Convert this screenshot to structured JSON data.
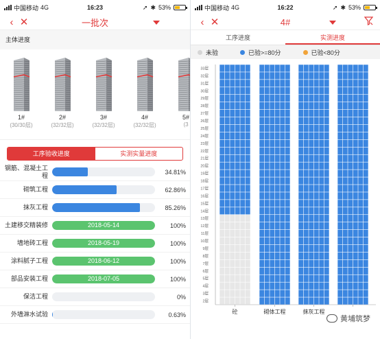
{
  "colors": {
    "accent": "#e03a3a",
    "blue": "#3b86e0",
    "green": "#5bc46f",
    "grey": "#e7e7e7",
    "orange": "#f1a43a"
  },
  "left": {
    "status": {
      "carrier": "中国移动",
      "network": "4G",
      "time": "16:23",
      "battery": "53%"
    },
    "nav": {
      "title": "一批次"
    },
    "section": "主体进度",
    "buildings": [
      {
        "name": "1#",
        "sub": "(30/30层)"
      },
      {
        "name": "2#",
        "sub": "(32/32层)"
      },
      {
        "name": "3#",
        "sub": "(32/32层)"
      },
      {
        "name": "4#",
        "sub": "(32/32层)"
      },
      {
        "name": "5#",
        "sub": "(3"
      }
    ],
    "tabs": [
      "工序验收进度",
      "实测实量进度"
    ],
    "rows": [
      {
        "label": "钢筋、混凝土工程",
        "progress": 0.3481,
        "pct": "34.81%"
      },
      {
        "label": "砌筑工程",
        "progress": 0.6286,
        "pct": "62.86%"
      },
      {
        "label": "抹灰工程",
        "progress": 0.8526,
        "pct": "85.26%"
      },
      {
        "label": "土建移交精装修",
        "progress": 1.0,
        "date": "2018-05-14",
        "pct": "100%"
      },
      {
        "label": "墙地砖工程",
        "progress": 1.0,
        "date": "2018-05-19",
        "pct": "100%"
      },
      {
        "label": "涂料腻子工程",
        "progress": 1.0,
        "date": "2018-06-12",
        "pct": "100%"
      },
      {
        "label": "部品安装工程",
        "progress": 1.0,
        "date": "2018-07-05",
        "pct": "100%"
      },
      {
        "label": "保洁工程",
        "progress": 0,
        "pct": "0%"
      },
      {
        "label": "外墙淋水试验",
        "progress": 0.0063,
        "pct": "0.63%"
      }
    ]
  },
  "right": {
    "status": {
      "carrier": "中国移动",
      "network": "4G",
      "time": "16:22",
      "battery": "53%"
    },
    "nav": {
      "title": "4#"
    },
    "tabs": [
      "工序进度",
      "实测进度"
    ],
    "legend": [
      {
        "label": "未验",
        "color": "#d6d6d6"
      },
      {
        "label": "已验>=80分",
        "color": "#3b86e0"
      },
      {
        "label": "已验<80分",
        "color": "#f1a43a"
      }
    ],
    "watermark": "黄埔筑梦"
  },
  "chart_data": {
    "type": "heatmap",
    "y_categories": [
      "2层",
      "3层",
      "4层",
      "5层",
      "6层",
      "7层",
      "8层",
      "9层",
      "10层",
      "11层",
      "12层",
      "13层",
      "14层",
      "15层",
      "16层",
      "17层",
      "18层",
      "19层",
      "20层",
      "21层",
      "22层",
      "23层",
      "24层",
      "25层",
      "26层",
      "27层",
      "28层",
      "29层",
      "30层",
      "31层",
      "32层",
      "33层"
    ],
    "columns": [
      {
        "name": "砼",
        "cells_per_floor": 6,
        "inspected_from_floor": "14层"
      },
      {
        "name": "砌体工程",
        "cells_per_floor": 6,
        "inspected_from_floor": "2层"
      },
      {
        "name": "抹灰工程",
        "cells_per_floor": 6,
        "inspected_from_floor": "2层"
      },
      {
        "name": "",
        "cells_per_floor": 6,
        "inspected_from_floor": "2层"
      }
    ],
    "legend": [
      "未验",
      "已验>=80分",
      "已验<80分"
    ]
  }
}
